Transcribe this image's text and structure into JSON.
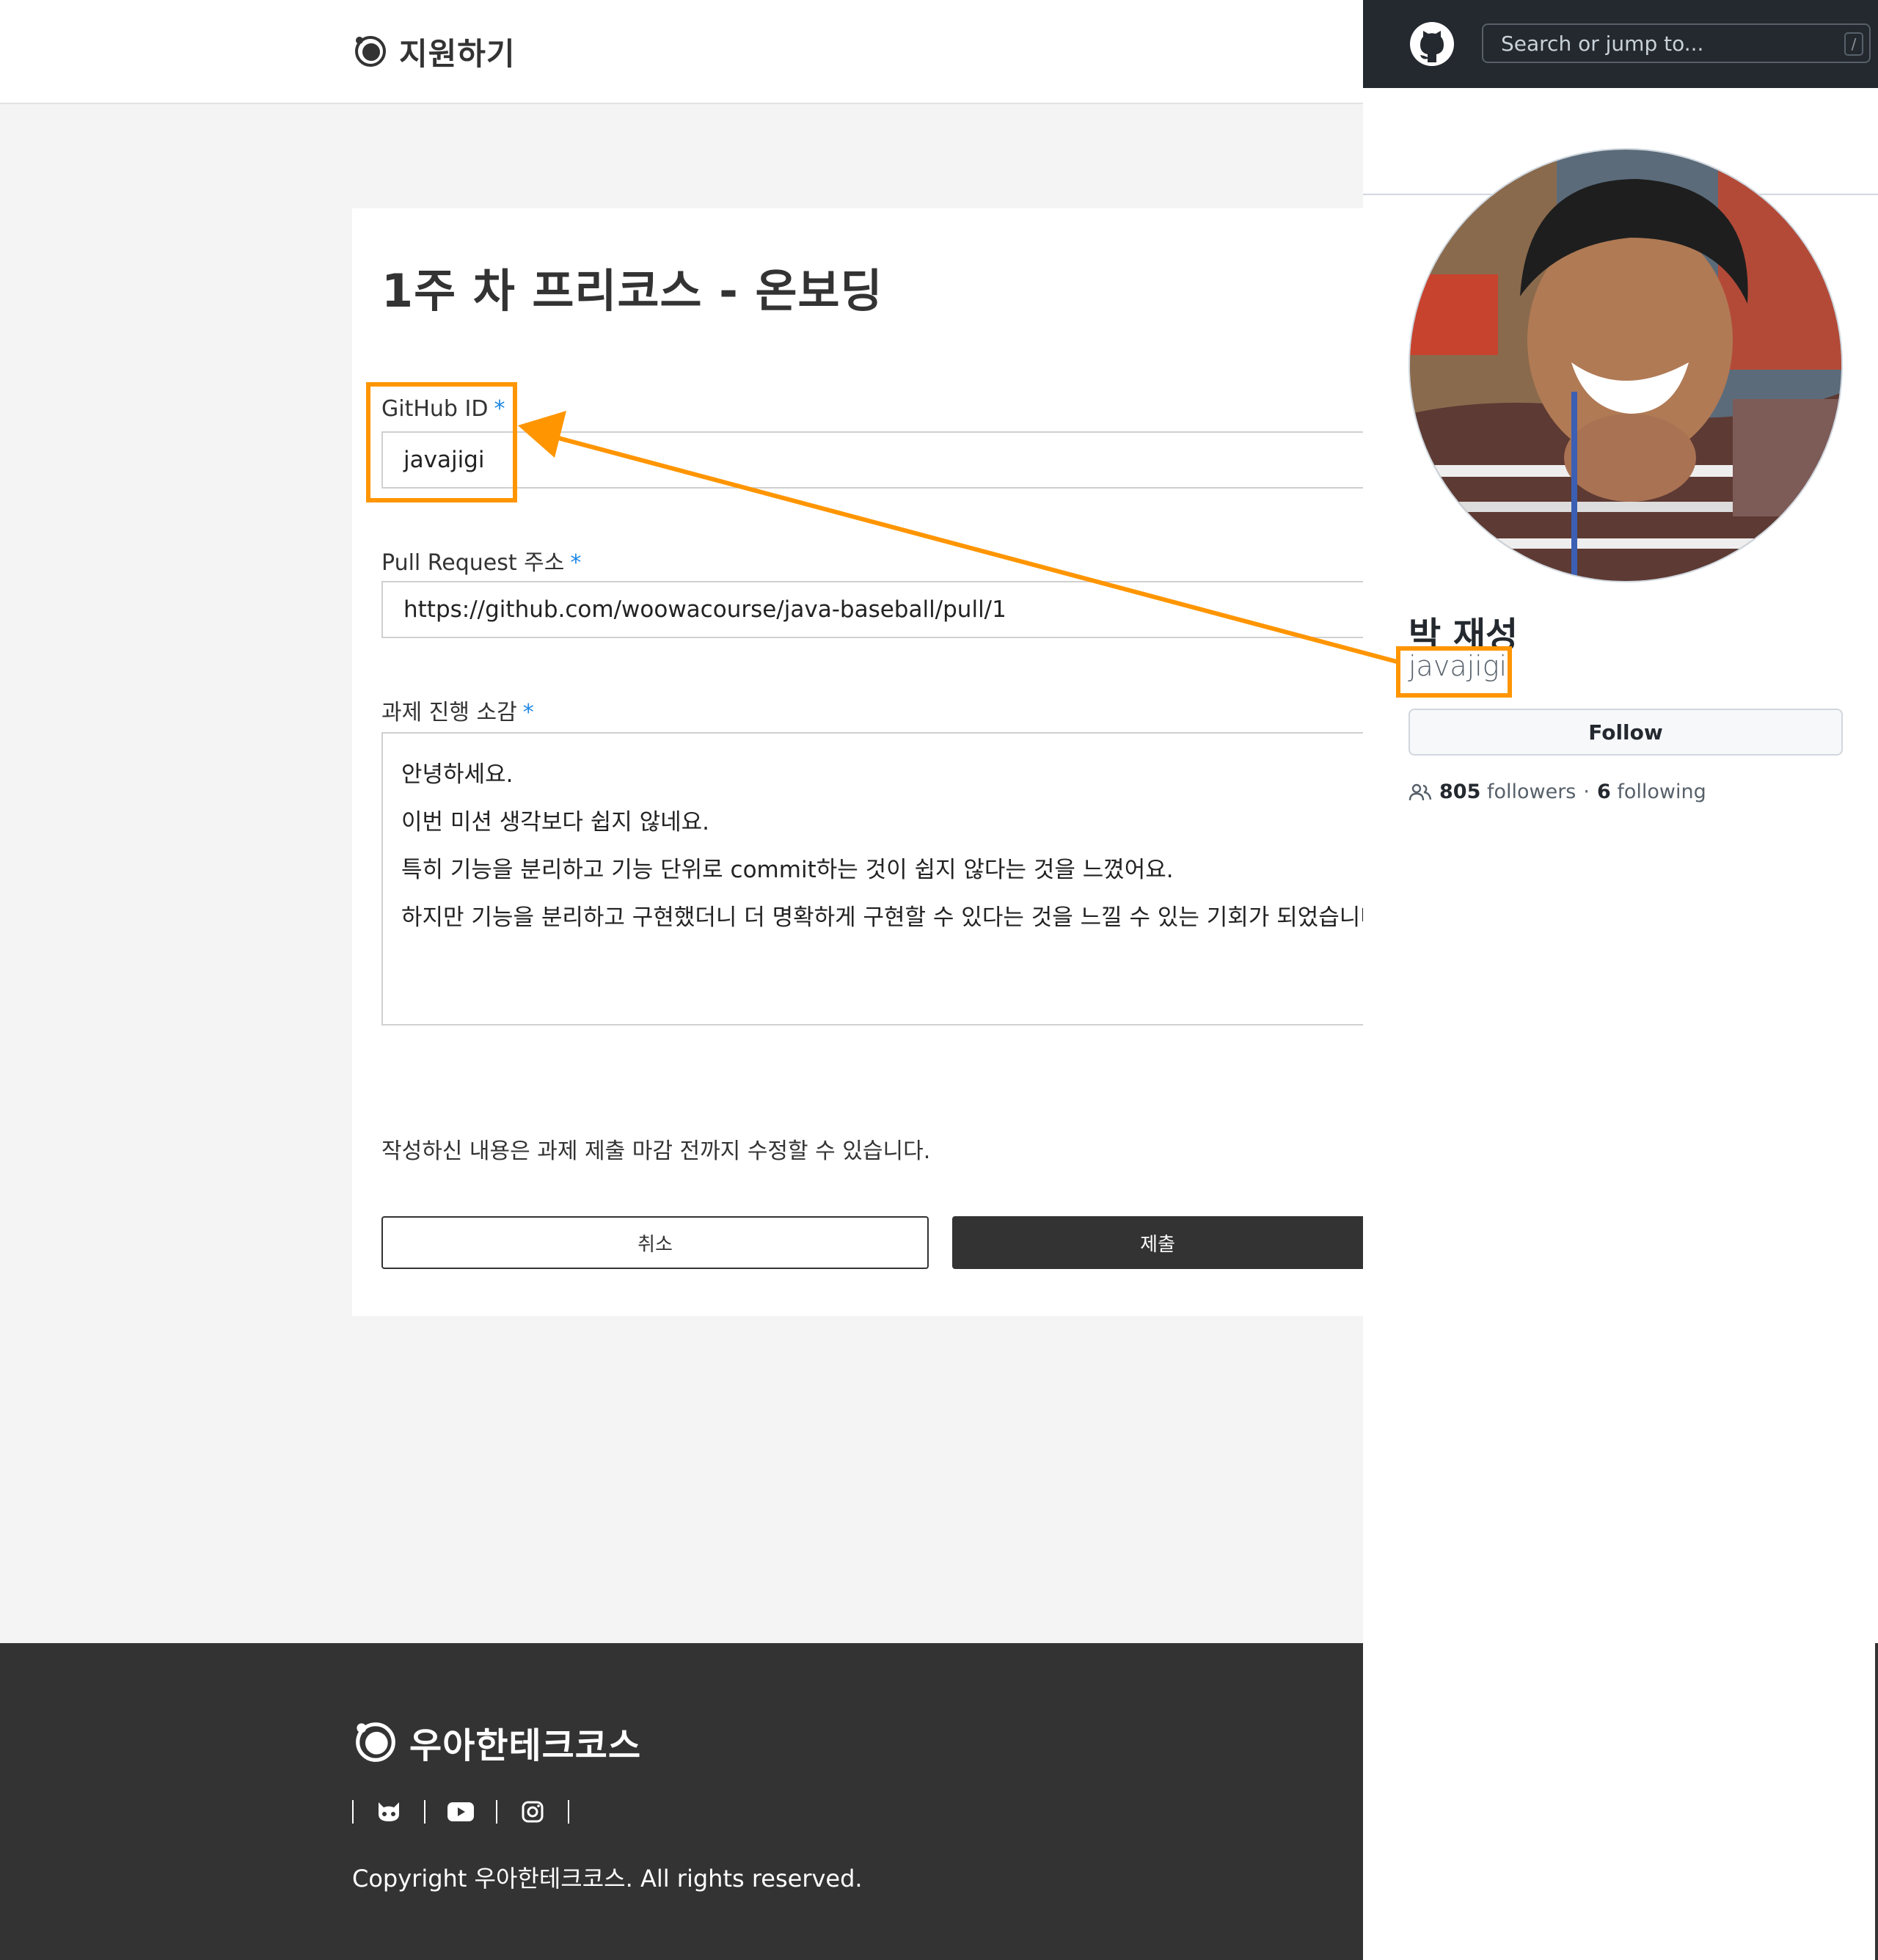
{
  "app": {
    "brand": "지원하기",
    "form": {
      "title": "1주 차 프리코스 - 온보딩",
      "required_mark": "*",
      "github_label": "GitHub ID",
      "github_value": "javajigi",
      "pr_label": "Pull Request 주소",
      "pr_value": "https://github.com/woowacourse/java-baseball/pull/1",
      "review_label": "과제 진행 소감",
      "review_lines": [
        "안녕하세요.",
        "이번 미션 생각보다 쉽지 않네요.",
        "특히 기능을 분리하고 기능 단위로 commit하는 것이 쉽지 않다는 것을 느꼈어요.",
        "하지만 기능을 분리하고 구현했더니 더 명확하게 구현할 수 있다는 것을 느낄 수 있는 기회가 되었습니다."
      ],
      "notice": "작성하신 내용은 과제 제출 마감 전까지 수정할 수 있습니다.",
      "cancel_label": "취소",
      "submit_label": "제출"
    },
    "footer": {
      "brand": "우아한테크코스",
      "social_icons": [
        "github-icon",
        "youtube-icon",
        "instagram-icon"
      ],
      "copyright": "Copyright 우아한테크코스. All rights reserved."
    }
  },
  "github": {
    "search_placeholder": "Search or jump to...",
    "search_shortcut": "/",
    "name": "박 재성",
    "login": "javajigi",
    "follow_label": "Follow",
    "followers_count": "805",
    "followers_label": "followers",
    "separator": "·",
    "following_count": "6",
    "following_label": "following"
  },
  "colors": {
    "annotation": "#ff9500",
    "required": "#1e88e5",
    "dark": "#333333",
    "github_header": "#24292f"
  }
}
